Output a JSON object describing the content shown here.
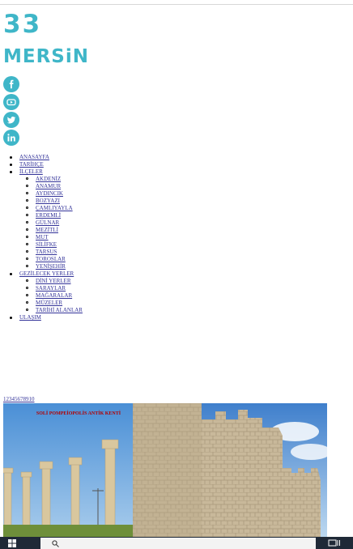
{
  "header": {
    "logo_number": "33",
    "logo_city": "MERSiN"
  },
  "social": {
    "icons": [
      "facebook-icon",
      "youtube-icon",
      "twitter-icon",
      "linkedin-icon"
    ],
    "color": "#3fb6c8"
  },
  "nav": {
    "items": [
      {
        "label": "ANASAYFA",
        "children": []
      },
      {
        "label": "TARİHÇE",
        "children": []
      },
      {
        "label": "İLÇELER",
        "children": [
          "AKDENİZ",
          "ANAMUR",
          "AYDINCIK",
          "BOZYAZI",
          "ÇAMLIYAYLA",
          "ERDEMLİ",
          "GÜLNAR",
          "MEZİTLİ",
          "MUT",
          "SİLİFKE",
          "TARSUS",
          "TOROSLAR",
          "YENİŞEHİR"
        ]
      },
      {
        "label": "GEZİLECEK YERLER",
        "children": [
          "DİNİ YERLER",
          "SARAYLAR",
          "MAĞARALAR",
          "MÜZELER",
          "TARİHİ ALANLAR"
        ]
      },
      {
        "label": "ULAŞIM",
        "children": []
      }
    ]
  },
  "phone": "12345678910",
  "banner": {
    "caption": "SOLİ POMPEİOPOLİS ANTİK KENTİ"
  }
}
